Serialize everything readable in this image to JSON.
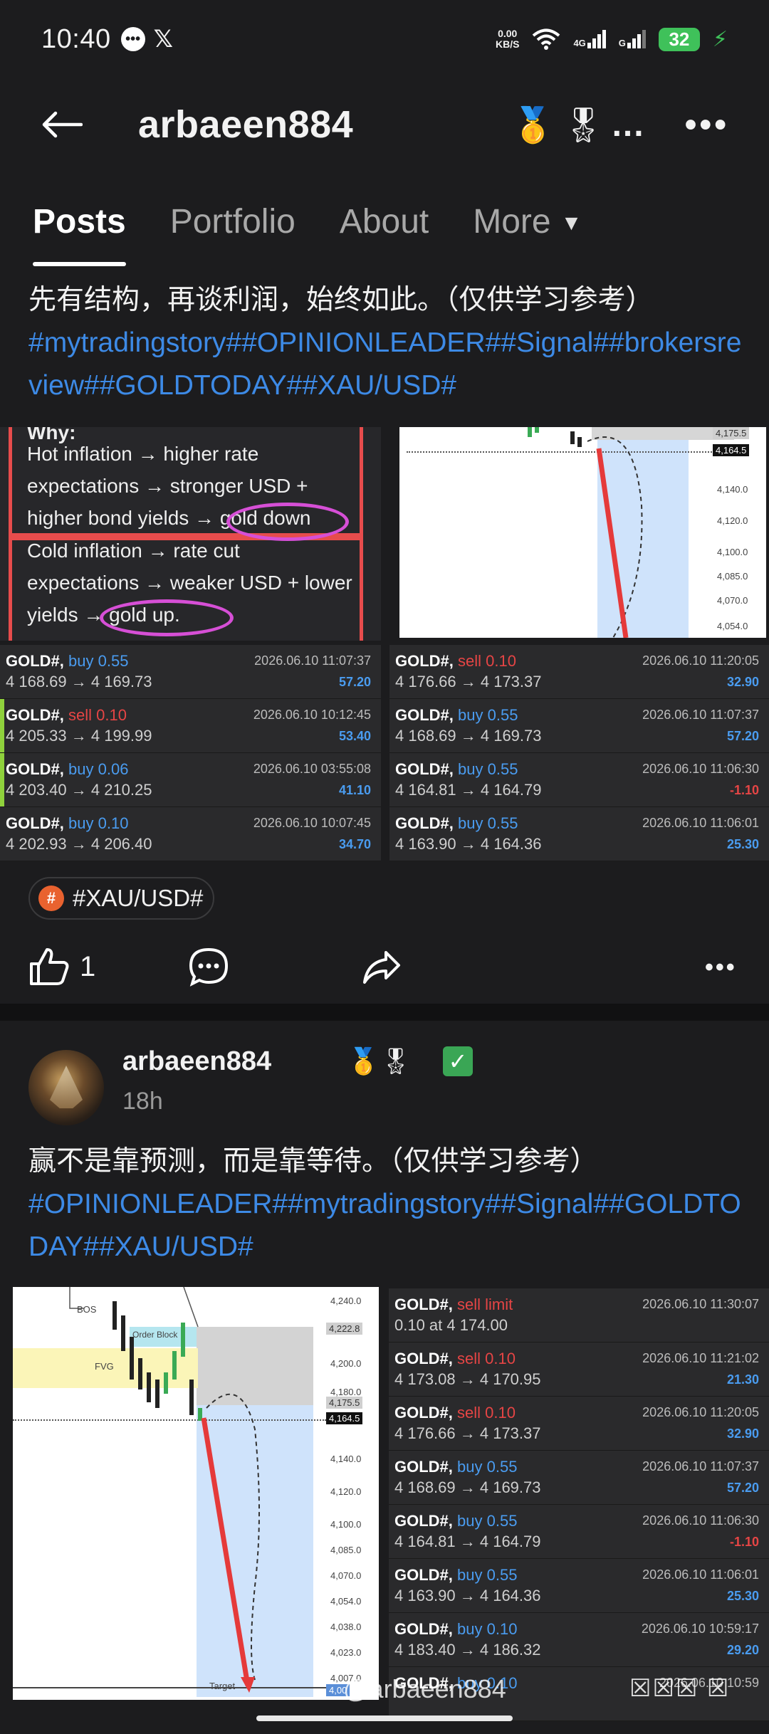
{
  "status_bar": {
    "time": "10:40",
    "net_speed_value": "0.00",
    "net_speed_unit": "KB/S",
    "signal1_label": "4G",
    "signal2_label": "G",
    "battery": "32"
  },
  "header": {
    "title": "arbaeen884",
    "badge_medal": "🥇",
    "badge_star": "🎖",
    "overflow_dots": "...",
    "menu_dots": "•••"
  },
  "tabs": [
    {
      "label": "Posts"
    },
    {
      "label": "Portfolio"
    },
    {
      "label": "About"
    },
    {
      "label": "More"
    }
  ],
  "post1": {
    "text": "先有结构，再谈利润，始终如此。（仅供学习参考）",
    "tags": "#mytradingstory##OPINIONLEADER##Signal##brokersreview##GOLDTODAY##XAU/USD#",
    "note_lines": [
      "Hot inflation → higher rate",
      "expectations → stronger USD +",
      "higher bond yields → gold down",
      "Cold inflation → rate cut",
      "expectations → weaker USD + lower",
      "yields → gold up."
    ],
    "note_partial_top": "Why:",
    "chart_labels": [
      "4,175.5",
      "4,164.5",
      "4,140.0",
      "4,120.0",
      "4,100.0",
      "4,085.0",
      "4,070.0",
      "4,054.0"
    ],
    "trades_left": [
      {
        "sym": "GOLD#,",
        "side": "buy",
        "lot": "0.55",
        "date": "2026.06.10 11:07:37",
        "px": "4 168.69 → 4 169.73",
        "pnl": "57.20",
        "bar": false
      },
      {
        "sym": "GOLD#,",
        "side": "sell",
        "lot": "0.10",
        "date": "2026.06.10 10:12:45",
        "px": "4 205.33 → 4 199.99",
        "pnl": "53.40",
        "bar": true
      },
      {
        "sym": "GOLD#,",
        "side": "buy",
        "lot": "0.06",
        "date": "2026.06.10 03:55:08",
        "px": "4 203.40 → 4 210.25",
        "pnl": "41.10",
        "bar": true
      },
      {
        "sym": "GOLD#,",
        "side": "buy",
        "lot": "0.10",
        "date": "2026.06.10 10:07:45",
        "px": "4 202.93 → 4 206.40",
        "pnl": "34.70",
        "bar": false
      }
    ],
    "trades_right": [
      {
        "sym": "GOLD#,",
        "side": "sell",
        "lot": "0.10",
        "date": "2026.06.10 11:20:05",
        "px": "4 176.66 → 4 173.37",
        "pnl": "32.90"
      },
      {
        "sym": "GOLD#,",
        "side": "buy",
        "lot": "0.55",
        "date": "2026.06.10 11:07:37",
        "px": "4 168.69 → 4 169.73",
        "pnl": "57.20"
      },
      {
        "sym": "GOLD#,",
        "side": "buy",
        "lot": "0.55",
        "date": "2026.06.10 11:06:30",
        "px": "4 164.81 → 4 164.79",
        "pnl": "-1.10"
      },
      {
        "sym": "GOLD#,",
        "side": "buy",
        "lot": "0.55",
        "date": "2026.06.10 11:06:01",
        "px": "4 163.90 → 4 164.36",
        "pnl": "25.30"
      }
    ],
    "topic_icon": "#",
    "topic": "#XAU/USD#",
    "like_count": "1"
  },
  "post2": {
    "author": "arbaeen884",
    "badges": "🥇🎖",
    "verified": "✓",
    "time": "18h",
    "text": "赢不是靠预测，而是靠等待。（仅供学习参考）",
    "tags": "#OPINIONLEADER##mytradingstory##Signal##GOLDTODAY##XAU/USD#",
    "chart_axis": [
      "4,240.0",
      "4,222.8",
      "4,200.0",
      "4,180.0",
      "4,175.5",
      "4,164.5",
      "4,140.0",
      "4,120.0",
      "4,100.0",
      "4,085.0",
      "4,070.0",
      "4,054.0",
      "4,038.0",
      "4,023.0",
      "4,007.0",
      "4,00"
    ],
    "chart_text": {
      "bos": "BOS",
      "order_block": "Order Block",
      "fvg": "FVG",
      "target": "Target"
    },
    "trades": [
      {
        "sym": "GOLD#,",
        "side": "sell limit",
        "lot": "",
        "date": "2026.06.10 11:30:07",
        "px": "0.10 at 4 174.00",
        "pnl": ""
      },
      {
        "sym": "GOLD#,",
        "side": "sell",
        "lot": "0.10",
        "date": "2026.06.10 11:21:02",
        "px": "4 173.08 → 4 170.95",
        "pnl": "21.30"
      },
      {
        "sym": "GOLD#,",
        "side": "sell",
        "lot": "0.10",
        "date": "2026.06.10 11:20:05",
        "px": "4 176.66 → 4 173.37",
        "pnl": "32.90"
      },
      {
        "sym": "GOLD#,",
        "side": "buy",
        "lot": "0.55",
        "date": "2026.06.10 11:07:37",
        "px": "4 168.69 → 4 169.73",
        "pnl": "57.20"
      },
      {
        "sym": "GOLD#,",
        "side": "buy",
        "lot": "0.55",
        "date": "2026.06.10 11:06:30",
        "px": "4 164.81 → 4 164.79",
        "pnl": "-1.10"
      },
      {
        "sym": "GOLD#,",
        "side": "buy",
        "lot": "0.55",
        "date": "2026.06.10 11:06:01",
        "px": "4 163.90 → 4 164.36",
        "pnl": "25.30"
      },
      {
        "sym": "GOLD#,",
        "side": "buy",
        "lot": "0.10",
        "date": "2026.06.10 10:59:17",
        "px": "4 183.40 → 4 186.32",
        "pnl": "29.20"
      },
      {
        "sym": "GOLD#,",
        "side": "buy",
        "lot": "0.10",
        "date": "2026.06.10 10:59",
        "px": "",
        "pnl": ""
      }
    ]
  },
  "watermark": {
    "text": "@arbaeen884",
    "boxes": "☒☒☒ ☒"
  }
}
